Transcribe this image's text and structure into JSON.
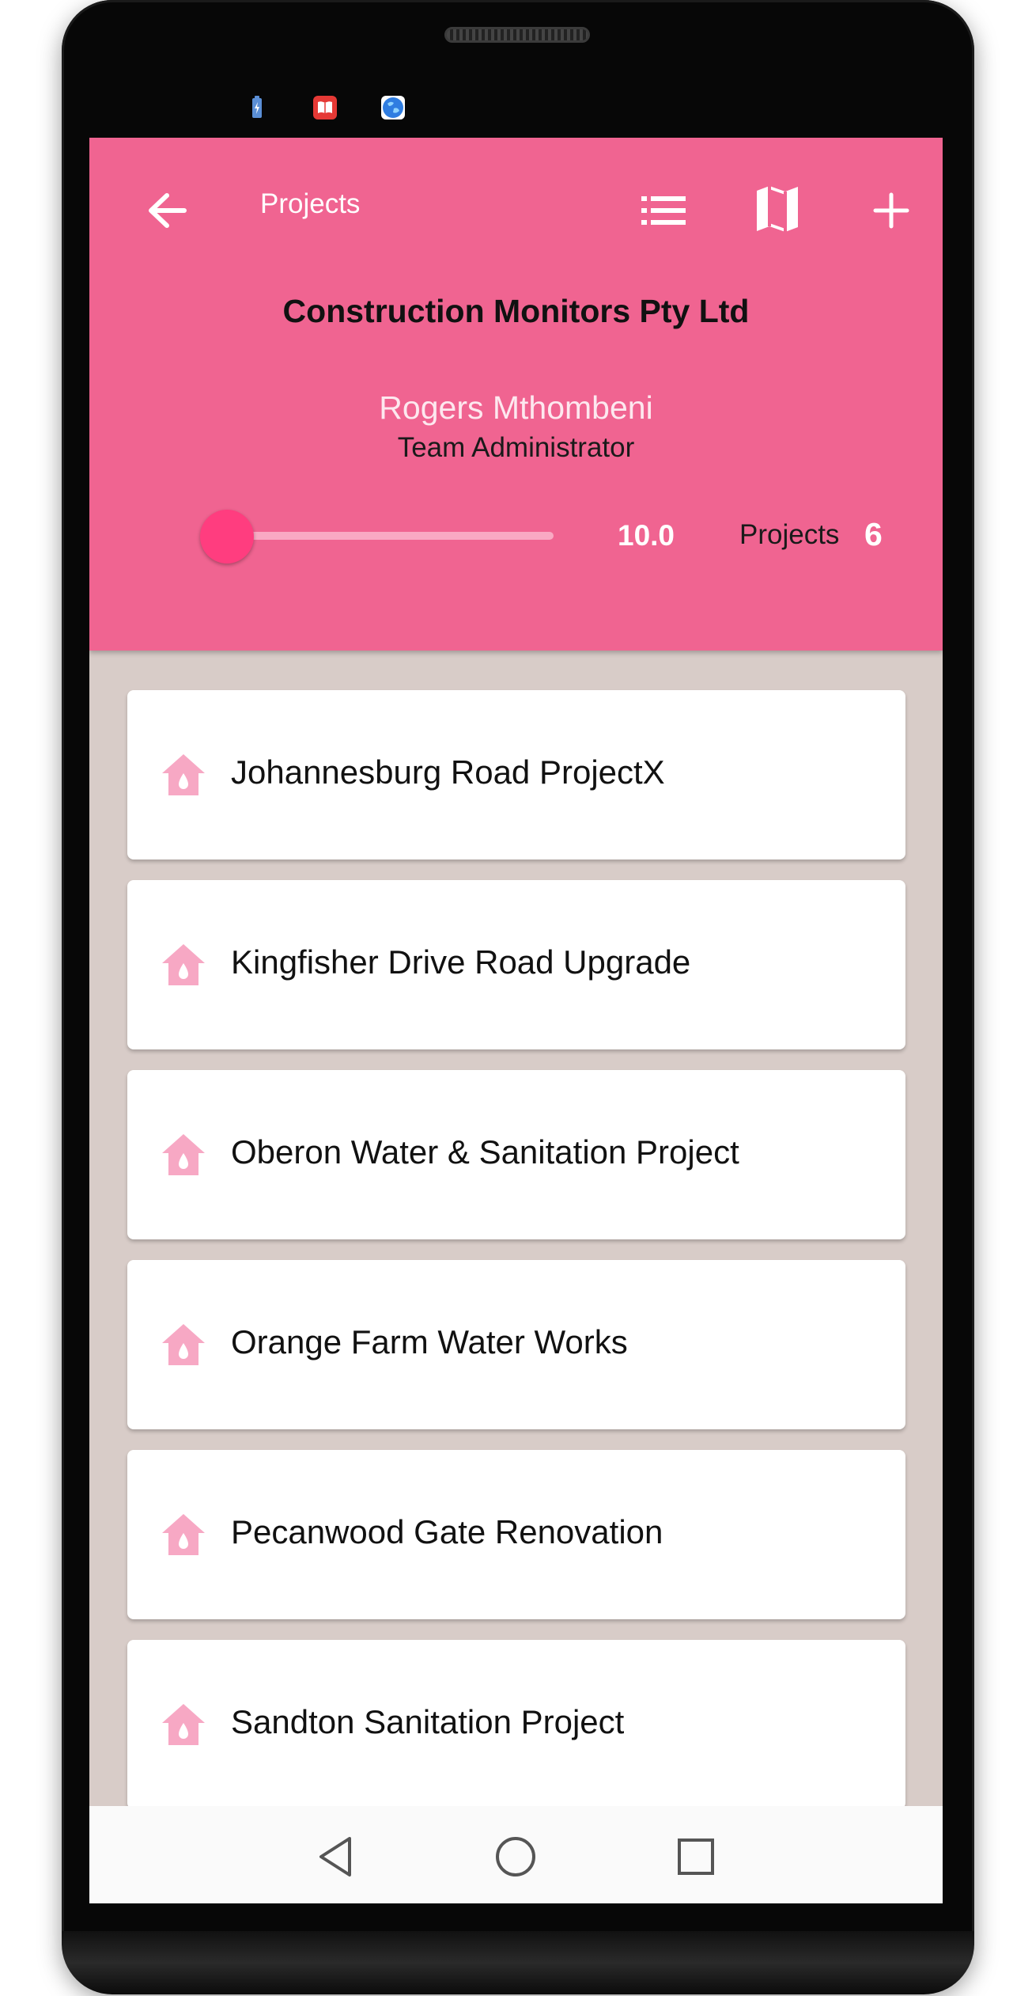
{
  "status_bar": {
    "icons": [
      "battery-charging-icon",
      "book-icon",
      "globe-icon"
    ]
  },
  "toolbar": {
    "title": "Projects",
    "back_icon": "arrow-left-icon",
    "list_icon": "list-icon",
    "map_icon": "map-icon",
    "add_icon": "plus-icon"
  },
  "header": {
    "company_name": "Construction Monitors Pty Ltd",
    "user_name": "Rogers Mthombeni",
    "user_role": "Team Administrator",
    "slider_value": "10.0",
    "slider_fraction": 0.0,
    "projects_label": "Projects",
    "projects_count": "6"
  },
  "projects": [
    {
      "name": "Johannesburg Road ProjectX"
    },
    {
      "name": "Kingfisher Drive Road Upgrade"
    },
    {
      "name": "Oberon Water & Sanitation Project"
    },
    {
      "name": "Orange Farm Water Works"
    },
    {
      "name": "Pecanwood Gate Renovation"
    },
    {
      "name": "Sandton Sanitation Project"
    }
  ],
  "navbar": {
    "back_icon": "triangle-back-icon",
    "home_icon": "circle-home-icon",
    "recents_icon": "square-recents-icon"
  },
  "colors": {
    "header_bg": "#f06491",
    "accent": "#ff3d7f",
    "list_bg": "#d8ccc8",
    "icon_pink": "#f7a8c4"
  }
}
